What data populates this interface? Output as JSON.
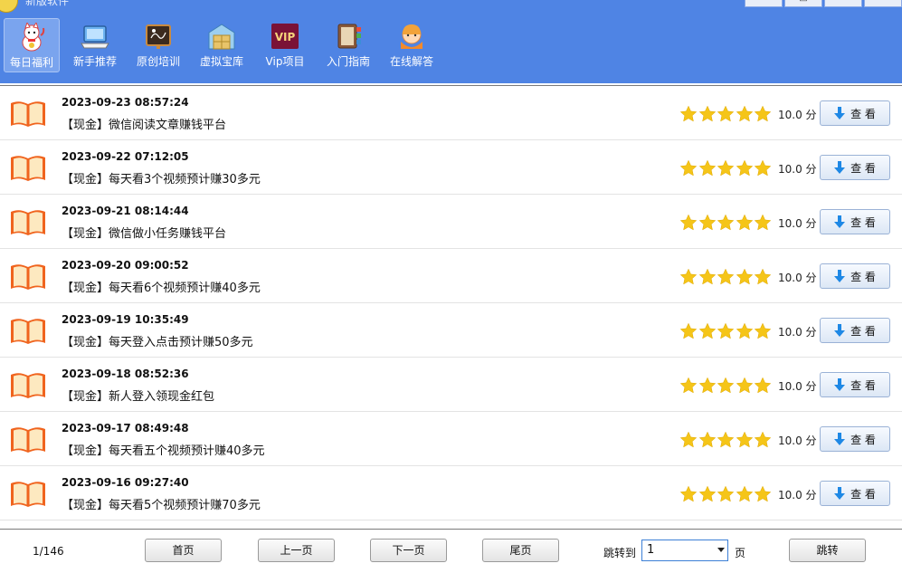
{
  "app": {
    "title": "新版软件",
    "window_buttons": [
      "—",
      "□",
      "❐",
      "✕"
    ]
  },
  "toolbar": [
    {
      "label": "每日福利",
      "icon": "lucky-cat-icon",
      "active": true
    },
    {
      "label": "新手推荐",
      "icon": "laptop-icon",
      "active": false
    },
    {
      "label": "原创培训",
      "icon": "chalkboard-icon",
      "active": false
    },
    {
      "label": "虚拟宝库",
      "icon": "warehouse-icon",
      "active": false
    },
    {
      "label": "Vip项目",
      "icon": "vip-badge-icon",
      "active": false
    },
    {
      "label": "入门指南",
      "icon": "guide-book-icon",
      "active": false
    },
    {
      "label": "在线解答",
      "icon": "support-agent-icon",
      "active": false
    }
  ],
  "items": [
    {
      "date": "2023-09-23 08:57:24",
      "title": "【现金】微信阅读文章赚钱平台",
      "rating": 5,
      "score": "10.0 分",
      "action": "查 看"
    },
    {
      "date": "2023-09-22 07:12:05",
      "title": "【现金】每天看3个视频预计赚30多元",
      "rating": 5,
      "score": "10.0 分",
      "action": "查 看"
    },
    {
      "date": "2023-09-21 08:14:44",
      "title": "【现金】微信做小任务赚钱平台",
      "rating": 5,
      "score": "10.0 分",
      "action": "查 看"
    },
    {
      "date": "2023-09-20 09:00:52",
      "title": "【现金】每天看6个视频预计赚40多元",
      "rating": 5,
      "score": "10.0 分",
      "action": "查 看"
    },
    {
      "date": "2023-09-19 10:35:49",
      "title": "【现金】每天登入点击预计赚50多元",
      "rating": 5,
      "score": "10.0 分",
      "action": "查 看"
    },
    {
      "date": "2023-09-18 08:52:36",
      "title": "【现金】新人登入领现金红包",
      "rating": 5,
      "score": "10.0 分",
      "action": "查 看"
    },
    {
      "date": "2023-09-17 08:49:48",
      "title": "【现金】每天看五个视频预计赚40多元",
      "rating": 5,
      "score": "10.0 分",
      "action": "查 看"
    },
    {
      "date": "2023-09-16 09:27:40",
      "title": "【现金】每天看5个视频预计赚70多元",
      "rating": 5,
      "score": "10.0 分",
      "action": "查 看"
    }
  ],
  "pager": {
    "page_info": "1/146",
    "first": "首页",
    "prev": "上一页",
    "next": "下一页",
    "last": "尾页",
    "jump_label": "跳转到",
    "jump_value": "1",
    "jump_suffix": "页",
    "jump_button": "跳转"
  },
  "colors": {
    "header_bg": "#4f84e4",
    "star": "#f5c518",
    "book": "#f0641e"
  }
}
